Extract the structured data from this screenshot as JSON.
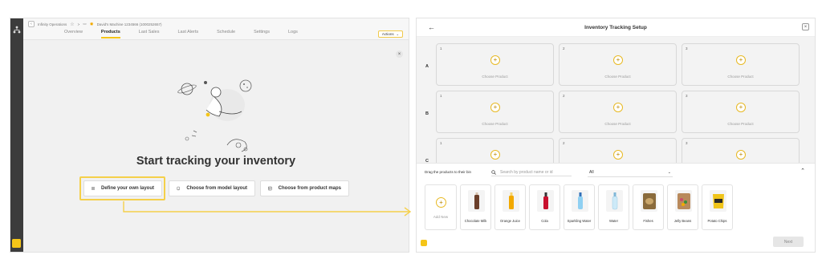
{
  "left": {
    "breadcrumb": {
      "org": "Infinity Operations",
      "separator": ">",
      "machine": "David's Machine 1234566 (1000252657)"
    },
    "tabs": [
      {
        "label": "Overview",
        "active": false
      },
      {
        "label": "Products",
        "active": true
      },
      {
        "label": "Last Sales",
        "active": false
      },
      {
        "label": "Last Alerts",
        "active": false
      },
      {
        "label": "Schedule",
        "active": false
      },
      {
        "label": "Settings",
        "active": false
      },
      {
        "label": "Logs",
        "active": false
      }
    ],
    "actions_label": "Actions",
    "hero_title": "Start tracking your inventory",
    "options": {
      "define": "Define your own layout",
      "model": "Choose from model layout",
      "maps": "Choose from product maps"
    }
  },
  "right": {
    "title": "Inventory Tracking Setup",
    "rows": [
      "A",
      "B",
      "C"
    ],
    "columns": [
      "1",
      "2",
      "3"
    ],
    "choose_product": "Choose Product",
    "drag_label": "Drag the products to their bin",
    "search_placeholder": "Search by product name or id",
    "filter_value": "All",
    "add_new": "Add New",
    "products": [
      {
        "name": "Chocolate Milk",
        "color": "#6b3f2a"
      },
      {
        "name": "Orange Juice",
        "color": "#f2a900"
      },
      {
        "name": "Cola",
        "color": "#c8102e"
      },
      {
        "name": "Sparkling Water",
        "color": "#8fd0f2"
      },
      {
        "name": "Water",
        "color": "#b9e3f7"
      },
      {
        "name": "Fishes",
        "color": "#8a6b3c"
      },
      {
        "name": "Jelly Beans",
        "color": "#c94b6d"
      },
      {
        "name": "Potato Chips",
        "color": "#f0c419"
      }
    ],
    "next_label": "Next"
  },
  "colors": {
    "accent": "#f5c518",
    "sidebar": "#3c3c3c",
    "highlight": "#f5d04a"
  }
}
